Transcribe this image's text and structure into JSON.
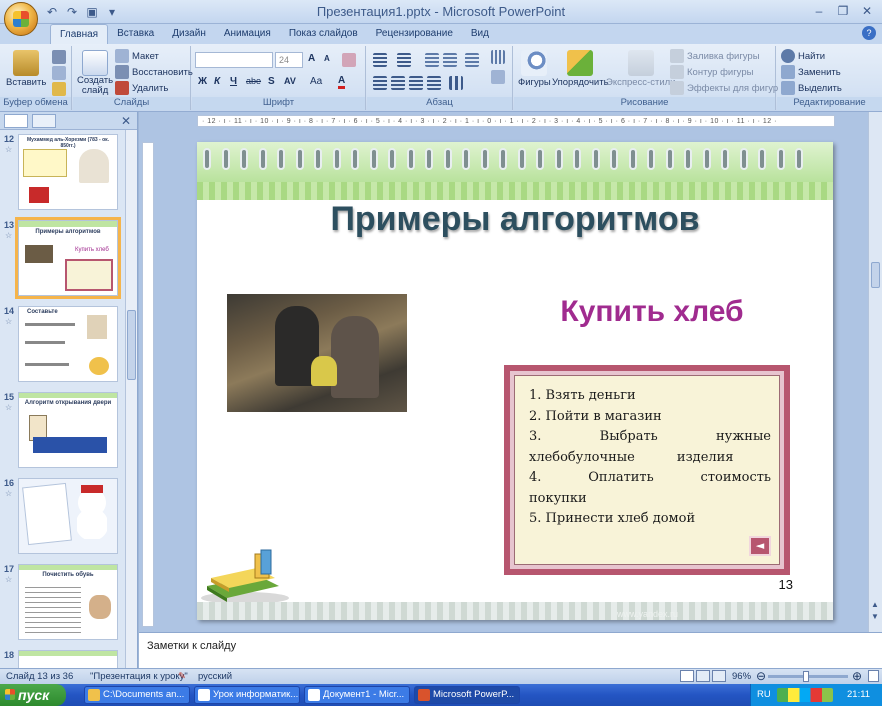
{
  "window": {
    "title": "Презентация1.pptx - Microsoft PowerPoint",
    "controls": [
      "–",
      "❐",
      "✕"
    ]
  },
  "ribbon": {
    "tabs": [
      "Главная",
      "Вставка",
      "Дизайн",
      "Анимация",
      "Показ слайдов",
      "Рецензирование",
      "Вид"
    ],
    "active_tab": "Главная",
    "clipboard": {
      "paste": "Вставить",
      "label": "Буфер обмена"
    },
    "slides": {
      "create": "Создать",
      "create2": "слайд",
      "layout": "Макет",
      "reset": "Восстановить",
      "delete": "Удалить",
      "label": "Слайды"
    },
    "font": {
      "size": "24",
      "label": "Шрифт",
      "bold": "Ж",
      "italic": "К",
      "underline": "Ч",
      "strike": "abe",
      "shadow": "S",
      "spacing": "AV",
      "case": "Aa",
      "color": "A",
      "grow": "A",
      "shrink": "A"
    },
    "paragraph": {
      "label": "Абзац"
    },
    "drawing": {
      "shapes": "Фигуры",
      "arrange": "Упорядочить",
      "quick_styles": "Экспресс-стили",
      "fill": "Заливка фигуры",
      "outline": "Контур фигуры",
      "effects": "Эффекты для фигур",
      "label": "Рисование"
    },
    "editing": {
      "find": "Найти",
      "replace": "Заменить",
      "select": "Выделить",
      "label": "Редактирование"
    }
  },
  "thumbnails": [
    {
      "num": "12",
      "title": "Мухаммед аль-Хорезми (783 - ок. 850гг.)"
    },
    {
      "num": "13",
      "title": "Примеры алгоритмов"
    },
    {
      "num": "14",
      "title": "Составьте"
    },
    {
      "num": "15",
      "title": "Алгоритм открывания двери"
    },
    {
      "num": "16",
      "title": ""
    },
    {
      "num": "17",
      "title": "Почистить обувь"
    },
    {
      "num": "18",
      "title": ""
    }
  ],
  "ruler": {
    "h": "· 12 · ı · 11 · ı · 10 · ı · 9 · ı · 8 · ı · 7 · ı · 6 · ı · 5 · ı · 4 · ı · 3 · ı · 2 · ı · 1 · ı · 0 · ı · 1 · ı · 2 · ı · 3 · ı · 4 · ı · 5 · ı · 6 · ı · 7 · ı · 8 · ı · 9 · ı · 10 · ı · 11 · ı · 12 ·"
  },
  "slide": {
    "title": "Примеры алгоритмов",
    "subheading": "Купить хлеб",
    "steps": [
      "1. Взять деньги",
      "2. Пойти в магазин",
      "3. Выбрать нужные хлебобулочные изделия",
      "4. Оплатить стоимость покупки",
      "5. Принести хлеб домой"
    ],
    "nav": "◄",
    "number": "13",
    "watermark": "www.yandex.ru"
  },
  "notes": {
    "placeholder": "Заметки к слайду"
  },
  "status": {
    "slide": "Слайд 13 из 36",
    "theme": "\"Презентация к уроку\"",
    "language": "русский",
    "zoom": "96%",
    "zoom_level": 0.48
  },
  "taskbar": {
    "start": "пуск",
    "items": [
      "C:\\Documents an...",
      "Урок информатик...",
      "Документ1 - Micr...",
      "Microsoft PowerP..."
    ],
    "lang": "RU",
    "time": "21:11"
  },
  "colors": {
    "title": "#2d4f5f",
    "subheading": "#a02b8f",
    "frame": "#b7566f",
    "taskbar": "#2455c3"
  }
}
